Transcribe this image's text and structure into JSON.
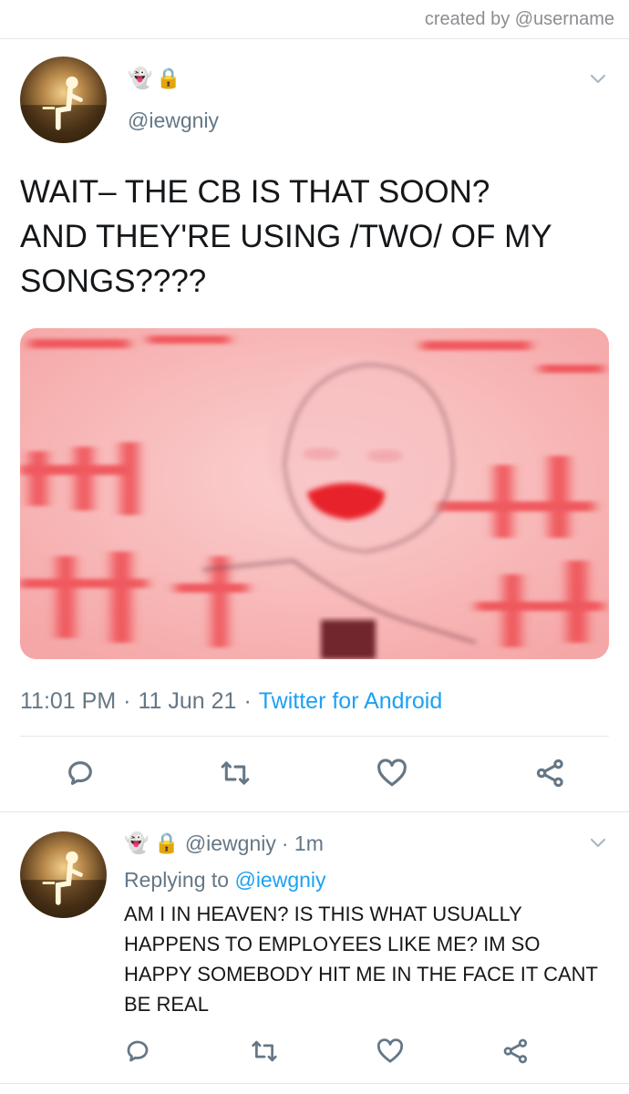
{
  "credit": "created by @username",
  "tweet": {
    "emojis": [
      "👻",
      "🔒"
    ],
    "handle": "@iewgniy",
    "text": "WAIT– THE CB IS THAT SOON?\nAND THEY'RE USING /TWO/ OF MY SONGS????",
    "time": "11:01 PM",
    "separator1": "·",
    "date": "11 Jun 21",
    "separator2": "·",
    "source": "Twitter for Android",
    "actions": [
      "reply-icon",
      "retweet-icon",
      "like-icon",
      "share-icon"
    ]
  },
  "reply": {
    "emojis": [
      "👻",
      "🔒"
    ],
    "handle": "@iewgniy",
    "age": "· 1m",
    "replying_prefix": "Replying to ",
    "replying_to": "@iewgniy",
    "text": "AM I IN HEAVEN? IS THIS WHAT USUALLY HAPPENS TO EMPLOYEES LIKE ME? IM SO HAPPY SOMEBODY HIT ME IN THE FACE IT CANT BE REAL",
    "actions": [
      "reply-icon",
      "retweet-icon",
      "like-icon",
      "share-icon"
    ]
  },
  "colors": {
    "accent": "#1da1f2",
    "secondary_text": "#657786",
    "meme_background": "#f7b3b3",
    "meme_red": "#e8232b"
  }
}
